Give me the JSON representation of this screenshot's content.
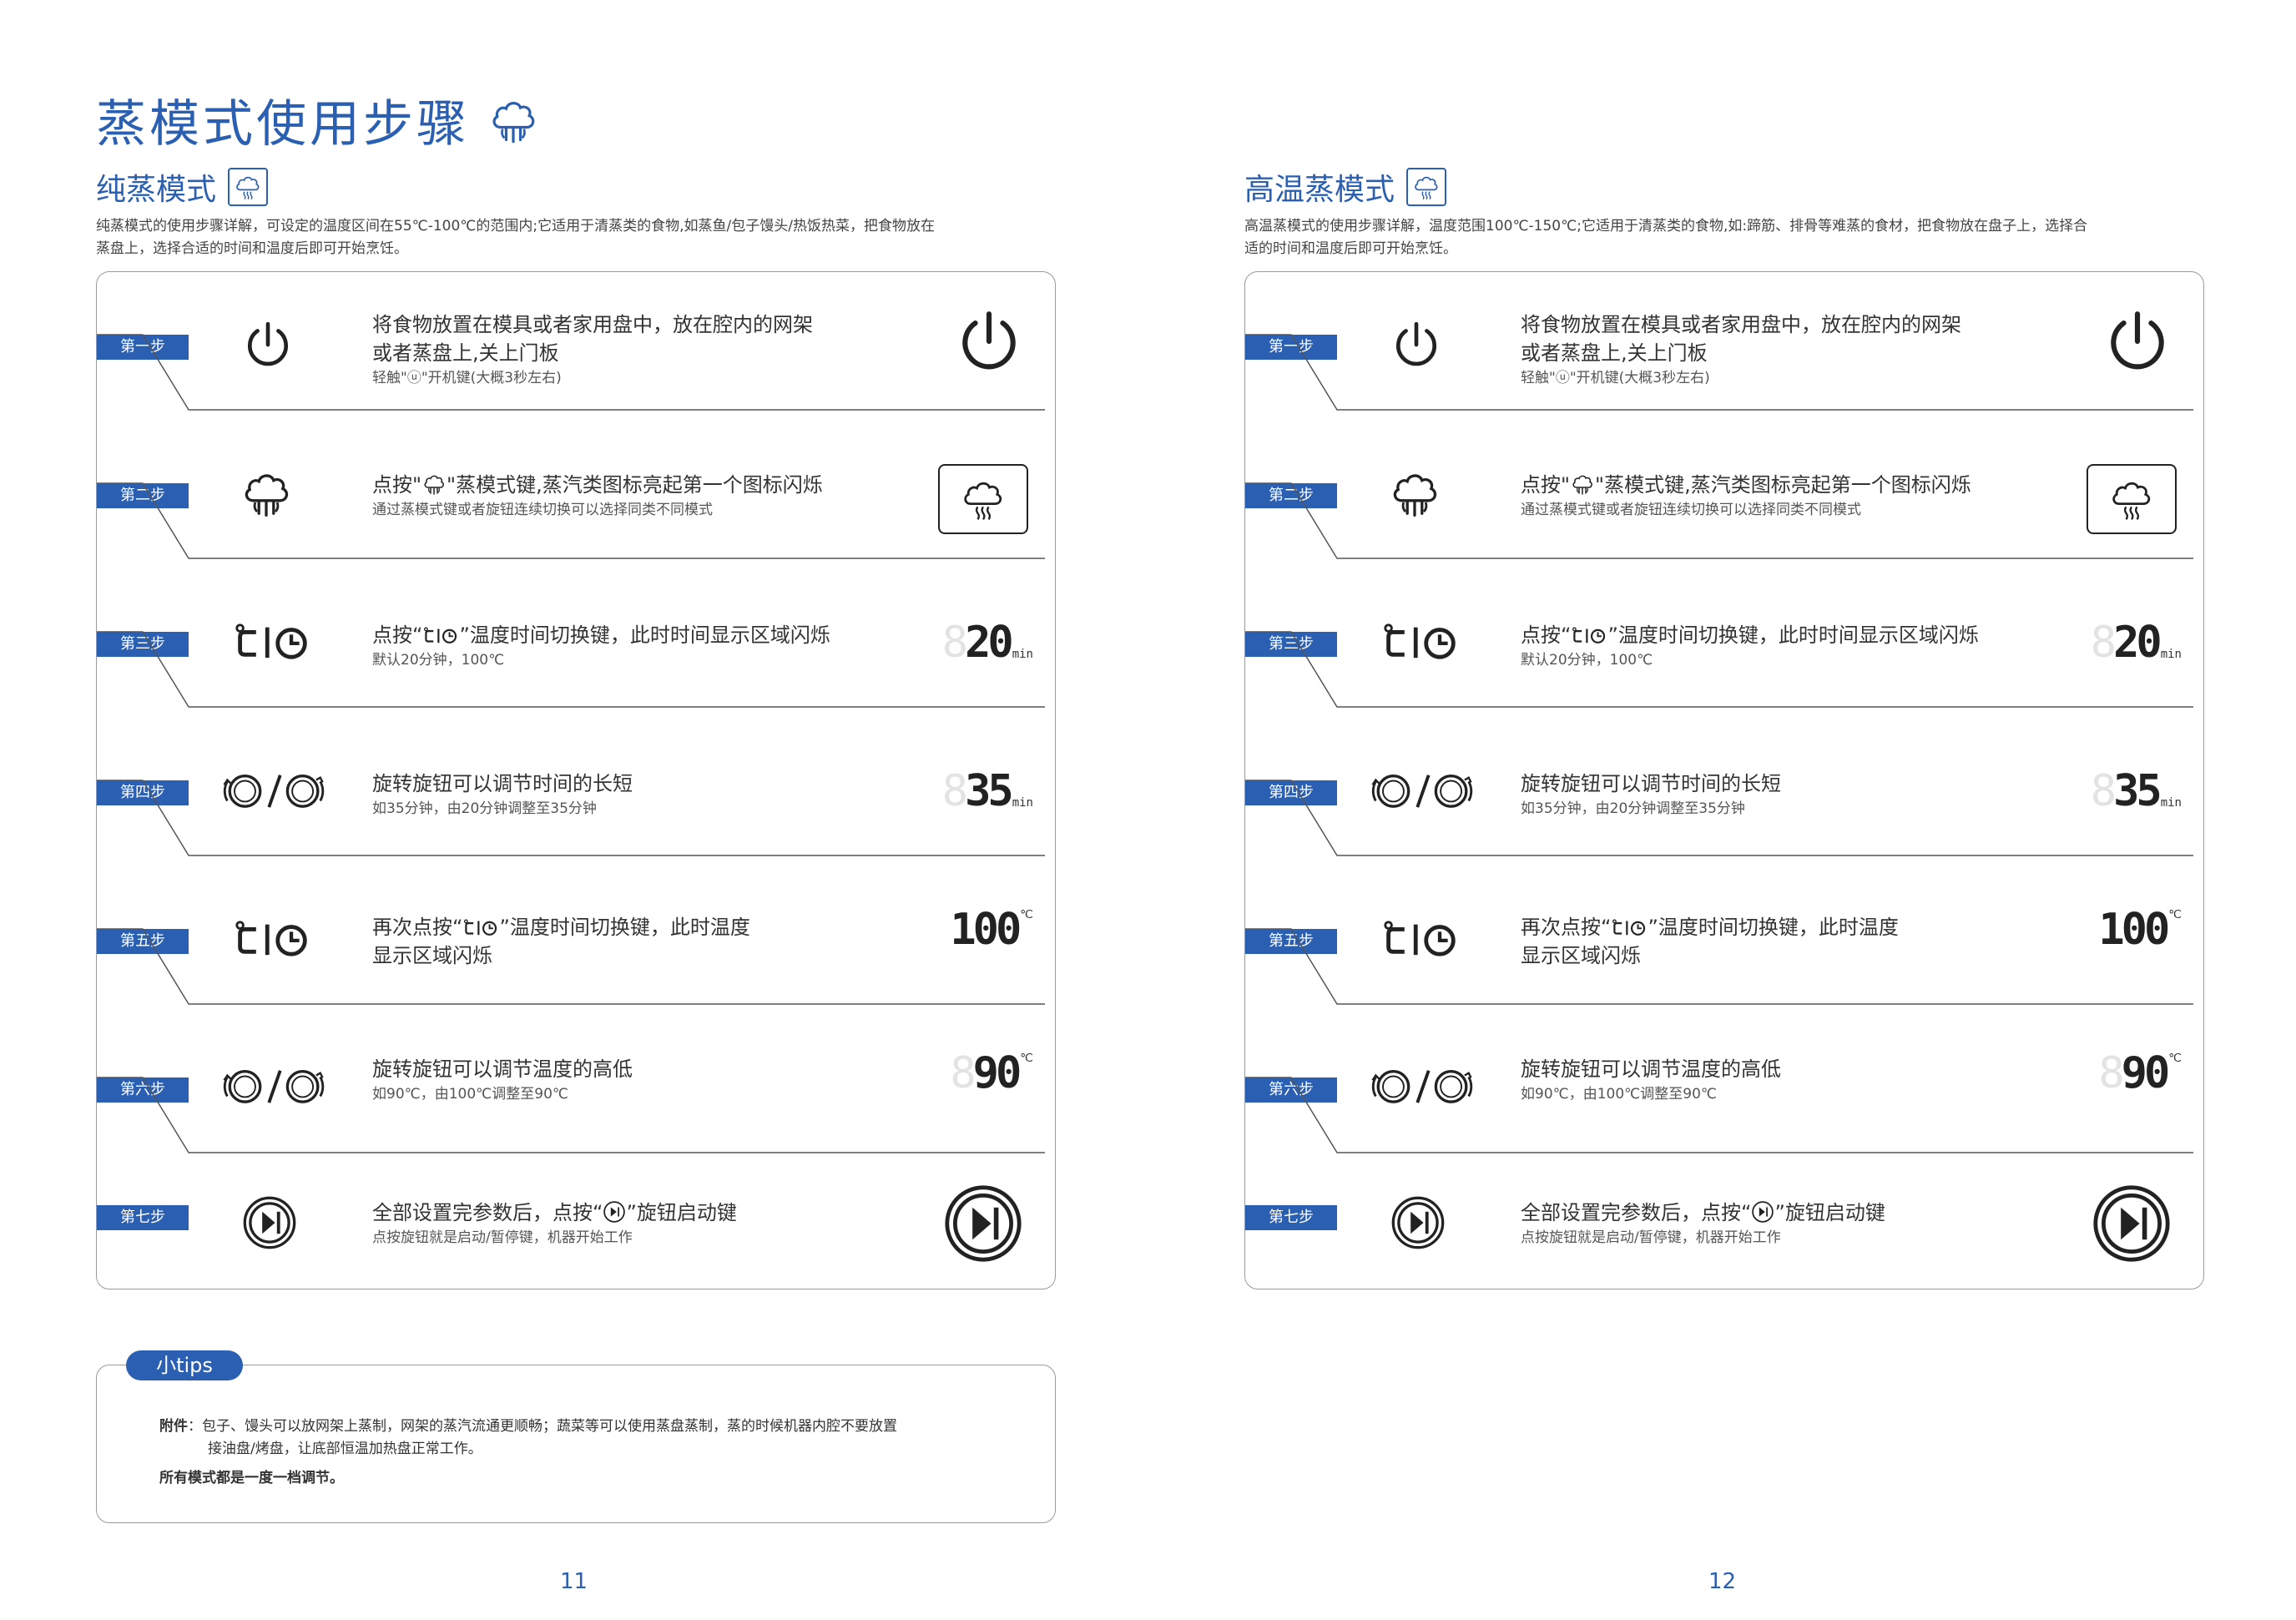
{
  "left_page": {
    "main_title": "蒸模式使用步骤",
    "section_title": "纯蒸模式",
    "description_line1": "纯蒸模式的使用步骤详解，可设定的温度区间在55℃-100℃的范围内;它适用于清蒸类的食物,如蒸鱼/包子馒头/热饭热菜，把食物放在",
    "description_line2": "蒸盘上，选择合适的时间和温度后即可开始烹饪。",
    "page_number": "11"
  },
  "right_page": {
    "section_title": "高温蒸模式",
    "description_line1": "高温蒸模式的使用步骤详解，温度范围100℃-150℃;它适用于清蒸类的食物,如:蹄筋、排骨等难蒸的食材，把食物放在盘子上，选择合",
    "description_line2": "适的时间和温度后即可开始烹饪。",
    "page_number": "12"
  },
  "steps": [
    {
      "label": "第一步",
      "main_line1": "将食物放置在模具或者家用盘中，放在腔内的网架",
      "main_line2": "或者蒸盘上,关上门板",
      "sub": "轻触\"ⓤ\"开机键(大概3秒左右)",
      "icon": "power-icon",
      "display_icon": "power-large-icon"
    },
    {
      "label": "第二步",
      "main_pre": "点按\"",
      "main_post": "\"蒸模式键,蒸汽类图标亮起第一个图标闪烁",
      "sub": "通过蒸模式键或者旋钮连续切换可以选择同类不同模式",
      "icon": "steam-icon",
      "display_icon": "steam-display-icon"
    },
    {
      "label": "第三步",
      "main_pre": "点按“",
      "main_post": "”温度时间切换键，此时时间显示区域闪烁",
      "sub": "默认20分钟，100℃",
      "icon": "temp-time-icon",
      "display_ghost": "8",
      "display_value": "20",
      "display_unit": "min"
    },
    {
      "label": "第四步",
      "main_line1": "旋转旋钮可以调节时间的长短",
      "sub": "如35分钟，由20分钟调整至35分钟",
      "icon": "knob-rotate-icon",
      "display_ghost": "8",
      "display_value": "35",
      "display_unit": "min"
    },
    {
      "label": "第五步",
      "main_pre": "再次点按“",
      "main_post": "”温度时间切换键，此时温度",
      "main_line2": "显示区域闪烁",
      "icon": "temp-time-icon",
      "display_ghost": "",
      "display_value": "100",
      "display_unit": "℃"
    },
    {
      "label": "第六步",
      "main_line1": "旋转旋钮可以调节温度的高低",
      "sub": "如90℃，由100℃调整至90℃",
      "icon": "knob-rotate-icon",
      "display_ghost": "8",
      "display_value": "90",
      "display_unit": "℃"
    },
    {
      "label": "第七步",
      "main_pre": "全部设置完参数后，点按“",
      "main_post": "”旋钮启动键",
      "sub": "点按旋钮就是启动/暂停键，机器开始工作",
      "icon": "play-pause-icon",
      "display_icon": "play-pause-large-icon"
    }
  ],
  "tips": {
    "label": "小tips",
    "attach_key": "附件",
    "attach_line1": "：包子、馒头可以放网架上蒸制，网架的蒸汽流通更顺畅；蔬菜等可以使用蒸盘蒸制，蒸的时候机器内腔不要放置",
    "attach_line2": "接油盘/烤盘，让底部恒温加热盘正常工作。",
    "note": "所有模式都是一度一档调节。"
  },
  "colors": {
    "accent": "#2b5fb2",
    "border": "#9a9a9a",
    "ghost_segment": "#e3e3e3"
  }
}
